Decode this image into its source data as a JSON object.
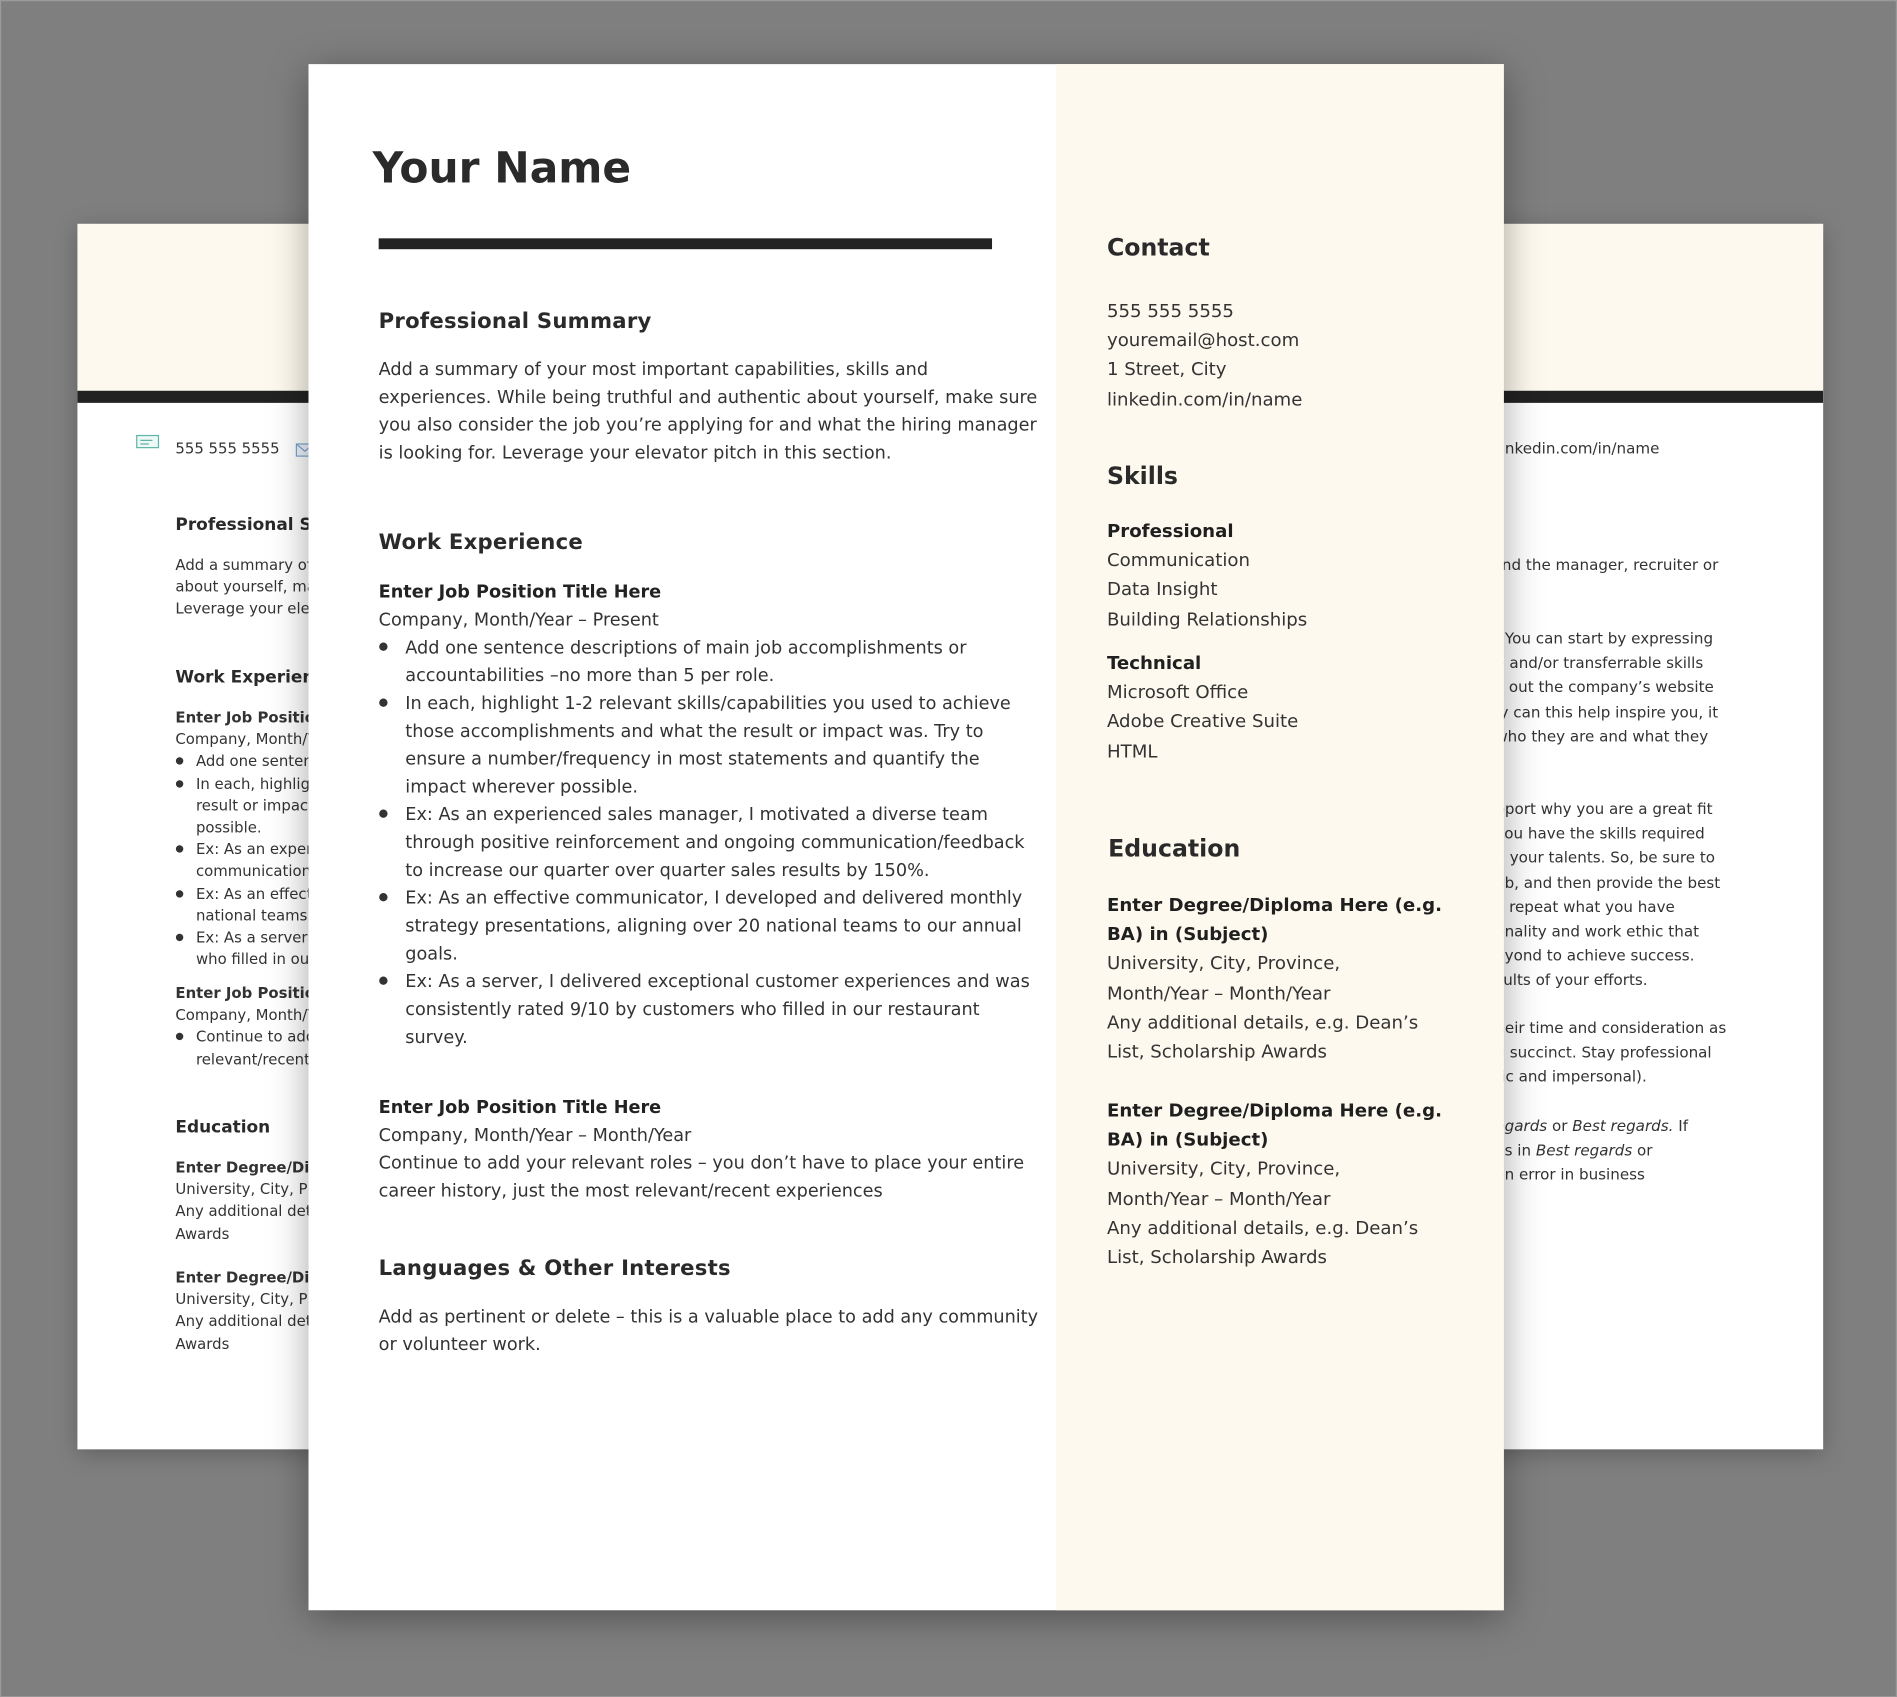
{
  "back_page": {
    "phone": "555 555 5555",
    "left_section_titles": {
      "summary": "Professional Sur",
      "work": "Work Experienc",
      "education": "Education"
    },
    "summary_lines": [
      "Add a summary of yo",
      "about yourself, make",
      "Leverage your elevat"
    ],
    "job1": {
      "title": "Enter Job Position",
      "company": "Company, Month/Ye",
      "bullets": [
        [
          "Add one sentence"
        ],
        [
          "In each, highlight",
          "result or impact w",
          "possible."
        ],
        [
          "Ex: As an experie",
          "communication/fe"
        ],
        [
          "Ex: As an effectiv",
          "national teams to"
        ],
        [
          "Ex: As a server, I",
          "who filled in our r"
        ]
      ]
    },
    "job2": {
      "title": "Enter Job Position",
      "company": "Company, Month/Ye",
      "bullets": [
        [
          "Continue to add y",
          "relevant/recent e"
        ]
      ]
    },
    "degree1": {
      "title": "Enter Degree/Diplor",
      "lines": [
        "University, City, Prov",
        "Any additional detail",
        "Awards"
      ]
    },
    "degree2": {
      "title": "Enter Degree/Diplor",
      "lines": [
        "University, City, Prov",
        "Any additional detail",
        "Awards"
      ]
    },
    "linkedin": "linkedin.com/in/name",
    "right_para1": [
      "ind the manager, recruiter or"
    ],
    "right_para2": [
      ". You can start by expressing",
      "e and/or transferrable skills",
      "k out the company’s website",
      "ly can this help inspire you, it",
      "who they are and what they"
    ],
    "right_para3": [
      "pport why you are a great fit",
      "you have the skills required",
      "g your talents. So, be sure to",
      "ob, and then provide the best",
      "y repeat what you have",
      "onality and work ethic that",
      "eyond to achieve success.",
      "sults of your efforts."
    ],
    "right_para4": [
      "heir time and consideration as",
      "d succinct. Stay professional",
      "tic and impersonal)."
    ],
    "right_para5": [
      [
        {
          "t": "egards",
          "i": true
        },
        {
          "t": " or "
        },
        {
          "t": "Best regards.",
          "i": true
        },
        {
          "t": " If"
        }
      ],
      [
        {
          "t": "as in "
        },
        {
          "t": "Best regards",
          "i": true
        },
        {
          "t": " or"
        }
      ],
      [
        {
          "t": "on error in business"
        }
      ]
    ]
  },
  "front_page": {
    "name": "Your Name",
    "summary": {
      "title": "Professional Summary",
      "lines": [
        "Add a summary of your most important capabilities, skills and",
        "experiences. While being truthful and authentic about yourself, make sure",
        "you also consider the job you’re applying for and what the hiring manager",
        "is looking for. Leverage your elevator pitch in this section."
      ]
    },
    "work": {
      "title": "Work Experience",
      "job1": {
        "title": "Enter Job Position Title Here",
        "company": "Company, Month/Year – Present",
        "bullets": [
          [
            "Add one sentence descriptions of main job accomplishments or",
            "accountabilities –no more than 5 per role."
          ],
          [
            "In each, highlight 1-2 relevant skills/capabilities you used to achieve",
            "those accomplishments and what the result or impact was. Try to",
            "ensure a number/frequency in most statements and quantify the",
            "impact wherever possible."
          ],
          [
            "Ex: As an experienced sales manager, I motivated a diverse team",
            "through positive reinforcement and ongoing communication/feedback",
            "to increase our quarter over quarter sales results by 150%."
          ],
          [
            "Ex: As an effective communicator, I developed and delivered monthly",
            "strategy presentations, aligning over 20 national teams to our annual",
            "goals."
          ],
          [
            "Ex: As a server, I delivered exceptional customer experiences and was",
            "consistently rated 9/10 by customers who filled in our restaurant",
            "survey."
          ]
        ]
      },
      "job2": {
        "title": "Enter Job Position Title Here",
        "company": "Company, Month/Year – Month/Year",
        "lines": [
          "Continue to add your relevant roles – you don’t have to place your entire",
          "career history, just the most relevant/recent experiences"
        ]
      }
    },
    "languages": {
      "title": "Languages & Other Interests",
      "lines": [
        "Add as pertinent or delete – this is a valuable place to add any community",
        "or volunteer work."
      ]
    },
    "contact": {
      "title": "Contact",
      "phone": "555 555 5555",
      "email": "youremail@host.com",
      "address": "1 Street, City",
      "linkedin": "linkedin.com/in/name"
    },
    "skills": {
      "title": "Skills",
      "professional_label": "Professional",
      "professional": [
        "Communication",
        "Data Insight",
        "Building Relationships"
      ],
      "technical_label": "Technical",
      "technical": [
        "Microsoft Office",
        "Adobe Creative Suite",
        "HTML"
      ]
    },
    "education": {
      "title": "Education",
      "degrees": [
        {
          "title": [
            "Enter Degree/Diploma Here (e.g.",
            "BA) in (Subject)"
          ],
          "lines": [
            "University, City, Province,",
            "Month/Year – Month/Year",
            "Any additional details, e.g. Dean’s",
            "List, Scholarship Awards"
          ]
        },
        {
          "title": [
            "Enter Degree/Diploma Here (e.g.",
            "BA) in (Subject)"
          ],
          "lines": [
            "University, City, Province,",
            "Month/Year – Month/Year",
            "Any additional details, e.g. Dean’s",
            "List, Scholarship Awards"
          ]
        }
      ]
    }
  },
  "colors": {
    "background": "#808080",
    "accent_cream": "#fdf9ee",
    "rule": "#222222",
    "icon_teal": "#5fb5a8"
  }
}
